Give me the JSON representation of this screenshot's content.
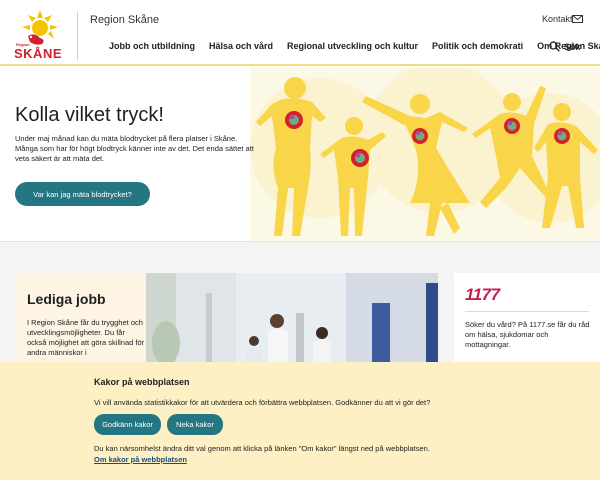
{
  "header": {
    "logo_small": "Region",
    "logo_text": "SKÅNE",
    "site_name": "Region Skåne",
    "kontakt": "Kontakt",
    "nav": [
      "Jobb och utbildning",
      "Hälsa och vård",
      "Regional utveckling och kultur",
      "Politik och demokrati",
      "Om Region Skåne"
    ],
    "search_label": "Sök"
  },
  "hero": {
    "title": "Kolla vilket tryck!",
    "text": "Under maj månad kan du mäta blodtrycket på flera platser i Skåne. Många som har för högt blodtryck känner inte av det. Det enda sättet att veta säkert är att mäta det.",
    "button": "Var kan jag mäta blodtrycket?"
  },
  "jobb": {
    "title": "Lediga jobb",
    "text": "I Region Skåne får du trygghet och utvecklingsmöjligheter. Du får också möjlighet att göra skillnad för andra människor i"
  },
  "card_1177": {
    "logo": "1177",
    "text": "Söker du vård? På 1177.se får du råd om hälsa, sjukdomar och mottagningar."
  },
  "cookie": {
    "title": "Kakor på webbplatsen",
    "text": "Vi vill använda statistikkakor för att utvärdera och förbättra webbplatsen. Godkänner du att vi gör det?",
    "accept": "Godkänn kakor",
    "decline": "Neka kakor",
    "note": "Du kan närsomhelst ändra ditt val genom att klicka på länken \"Om kakor\" längst ned på webbplatsen.",
    "link": "Om kakor på webbplatsen"
  },
  "colors": {
    "accent": "#247682",
    "brand_red": "#d4202c",
    "brand_yellow": "#f5c400",
    "cookie_bg": "#fdf0c4",
    "logo_1177": "#c21f4e"
  }
}
